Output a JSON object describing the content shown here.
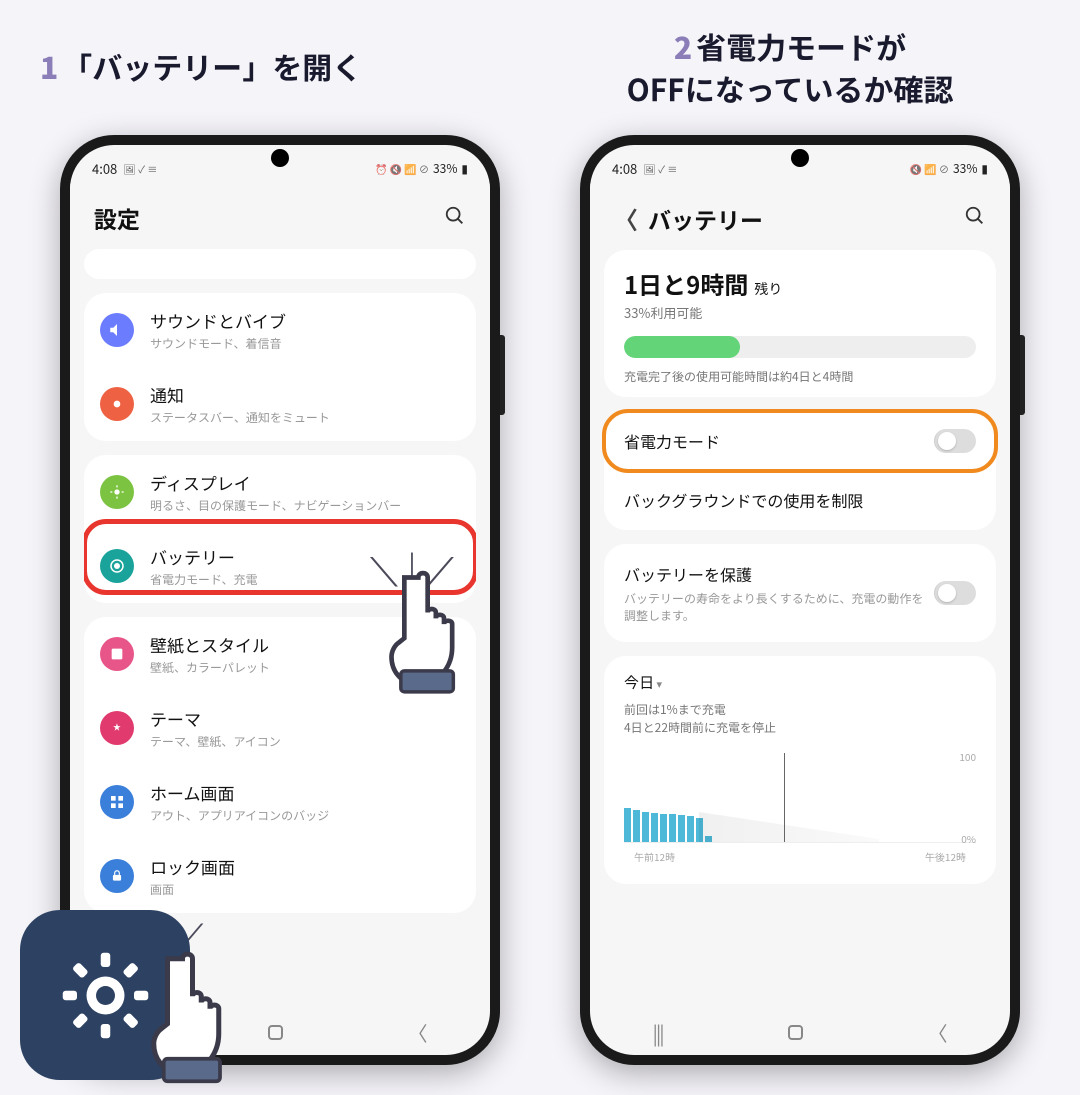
{
  "steps": {
    "s1_num": "1",
    "s1_text": "「バッテリー」を開く",
    "s2_num": "2",
    "s2_line1": "省電力モードが",
    "s2_line2": "OFFになっているか確認"
  },
  "statusbar": {
    "time": "4:08",
    "battery_text": "33%"
  },
  "colors": {
    "sound": "#6b7cff",
    "notif": "#ee6243",
    "display": "#7cc342",
    "battery": "#1aa39a",
    "wallpaper": "#e85589",
    "theme": "#e03a6e",
    "home": "#3a7fd9",
    "lock": "#3a7fd9"
  },
  "left": {
    "title": "設定",
    "items": [
      {
        "title": "サウンドとバイブ",
        "sub": "サウンドモード、着信音"
      },
      {
        "title": "通知",
        "sub": "ステータスバー、通知をミュート"
      },
      {
        "title": "ディスプレイ",
        "sub": "明るさ、目の保護モード、ナビゲーションバー"
      },
      {
        "title": "バッテリー",
        "sub": "省電力モード、充電"
      },
      {
        "title": "壁紙とスタイル",
        "sub": "壁紙、カラーパレット"
      },
      {
        "title": "テーマ",
        "sub": "テーマ、壁紙、アイコン"
      },
      {
        "title": "ホーム画面",
        "sub": "アウト、アプリアイコンのバッジ"
      },
      {
        "title": "ロック画面",
        "sub": "画面"
      }
    ]
  },
  "right": {
    "title": "バッテリー",
    "time_remaining": "1日と9時間",
    "time_suffix": "残り",
    "percent_line": "33%利用可能",
    "full_note": "充電完了後の使用可能時間は約4日と4時間",
    "power_mode": "省電力モード",
    "background_limit": "バックグラウンドでの使用を制限",
    "protect_title": "バッテリーを保護",
    "protect_sub": "バッテリーの寿命をより長くするために、充電の動作を調整します。",
    "today": "今日",
    "today_line1": "前回は1%まで充電",
    "today_line2": "4日と22時間前に充電を停止",
    "graph_100": "100",
    "graph_0": "0%",
    "axis_left": "午前12時",
    "axis_right": "午後12時"
  },
  "chart_data": {
    "type": "bar",
    "title": "今日",
    "xlabel": "",
    "ylabel": "%",
    "ylim": [
      0,
      100
    ],
    "x_ticks": [
      "午前12時",
      "午後12時"
    ],
    "values": [
      38,
      36,
      34,
      33,
      32,
      31,
      30,
      29,
      27,
      7
    ]
  }
}
